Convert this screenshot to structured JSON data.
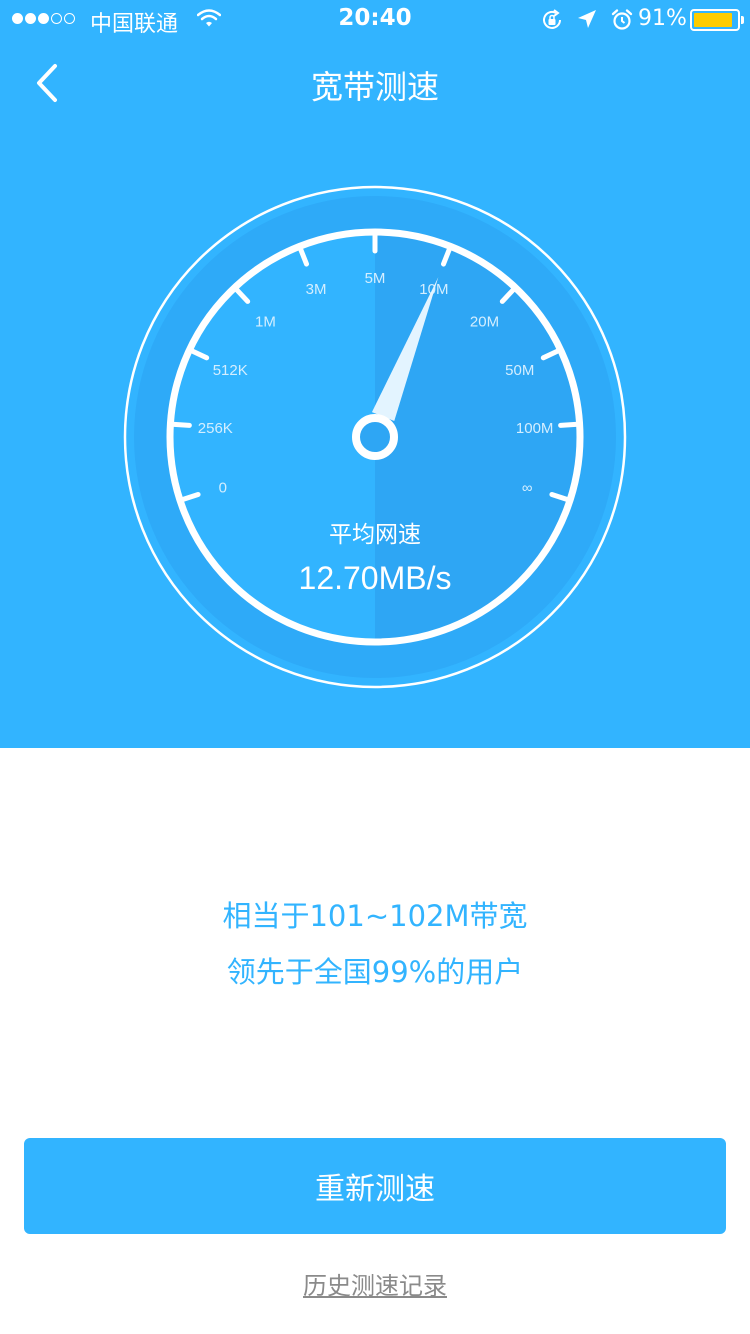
{
  "status_bar": {
    "signal_bars": 3,
    "signal_total": 5,
    "carrier": "中国联通",
    "time": "20:40",
    "battery_percent_label": "91%",
    "battery_level": 0.91,
    "icons": [
      "wifi-icon",
      "rotation-lock-icon",
      "location-arrow-icon",
      "alarm-icon",
      "battery-icon"
    ]
  },
  "nav": {
    "back_icon": "chevron-left-icon",
    "title": "宽带测速"
  },
  "gauge": {
    "scale_labels": [
      "0",
      "256K",
      "512K",
      "1M",
      "3M",
      "5M",
      "10M",
      "20M",
      "50M",
      "100M",
      "∞"
    ],
    "needle_position": "10M",
    "average_label": "平均网速",
    "average_value": "12.70MB/s"
  },
  "result": {
    "line1": "相当于101~102M带宽",
    "line2": "领先于全国99%的用户"
  },
  "actions": {
    "retest_label": "重新测速",
    "history_label": "历史测速记录"
  },
  "colors": {
    "primary": "#32b4ff",
    "gauge_inner": "#2ea6f4",
    "battery_fill": "#ffcc00",
    "text_muted": "#8a8a8a"
  }
}
